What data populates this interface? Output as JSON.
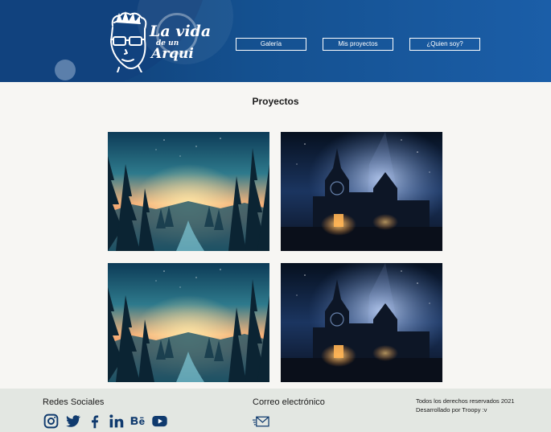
{
  "header": {
    "logo": {
      "line1": "La vida",
      "line2": "de un",
      "line3": "Arqui"
    },
    "nav": [
      {
        "label": "Galería"
      },
      {
        "label": "Mis proyectos"
      },
      {
        "label": "¿Quien soy?"
      }
    ],
    "colors": {
      "background": "#14508f",
      "button_border": "#ffffff"
    }
  },
  "main": {
    "title": "Proyectos",
    "projects": [
      {
        "image": "forest-sunset-river"
      },
      {
        "image": "night-cathedral"
      },
      {
        "image": "forest-sunset-river"
      },
      {
        "image": "night-cathedral"
      }
    ]
  },
  "footer": {
    "social_title": "Redes Sociales",
    "social_icons": [
      "instagram-icon",
      "twitter-icon",
      "facebook-icon",
      "linkedin-icon",
      "behance-icon",
      "youtube-icon"
    ],
    "mail_title": "Correo electrónico",
    "mail_icon": "envelope-icon",
    "rights_line1": "Todos los derechos reservados 2021",
    "rights_line2": "Desarrollado por Troopy :v",
    "background": "#e3e7e2",
    "icon_color": "#0f3a6e"
  }
}
